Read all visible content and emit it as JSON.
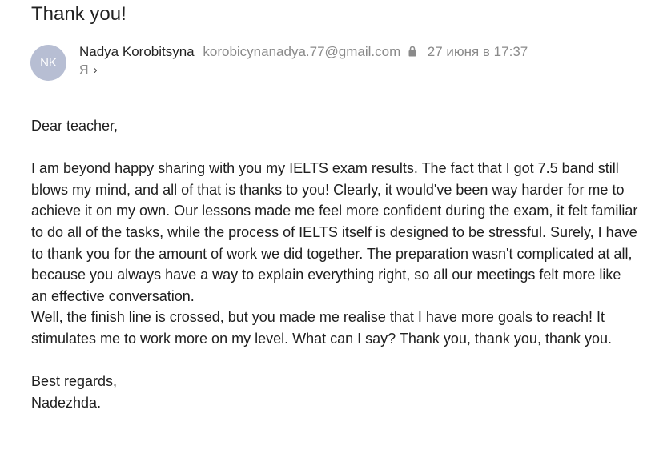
{
  "email": {
    "subject": "Thank you!",
    "avatar_initials": "NK",
    "sender_name": "Nadya Korobitsyna",
    "sender_email": "korobicynanadya.77@gmail.com",
    "date": "27 июня в 17:37",
    "recipient": "Я",
    "recipient_chevron": "›"
  },
  "body": {
    "greeting": "Dear teacher,",
    "p1": "I am beyond happy sharing with you my IELTS exam results. The fact that I got 7.5 band still blows my mind, and all of that is thanks to you! Clearly, it would've been way harder for me to achieve it on my own. Our lessons made me feel more confident during the exam, it felt familiar to do all of the tasks, while the process of IELTS itself is designed to be stressful. Surely, I have to thank you for the amount of work we did together. The preparation wasn't complicated at all, because you always have a way to explain everything right, so all our meetings felt more like an effective conversation.",
    "p2": "Well, the finish line is crossed, but you made me realise that I have more goals to reach! It stimulates me to work more on my level. What can I say? Thank you, thank you, thank you.",
    "closing": "Best regards,",
    "signature": "Nadezhda."
  },
  "colors": {
    "avatar_bg": "#b7bed3",
    "muted_text": "#8a8a8a"
  },
  "icons": {
    "lock": "lock-icon",
    "chevron": "chevron-right-icon"
  }
}
